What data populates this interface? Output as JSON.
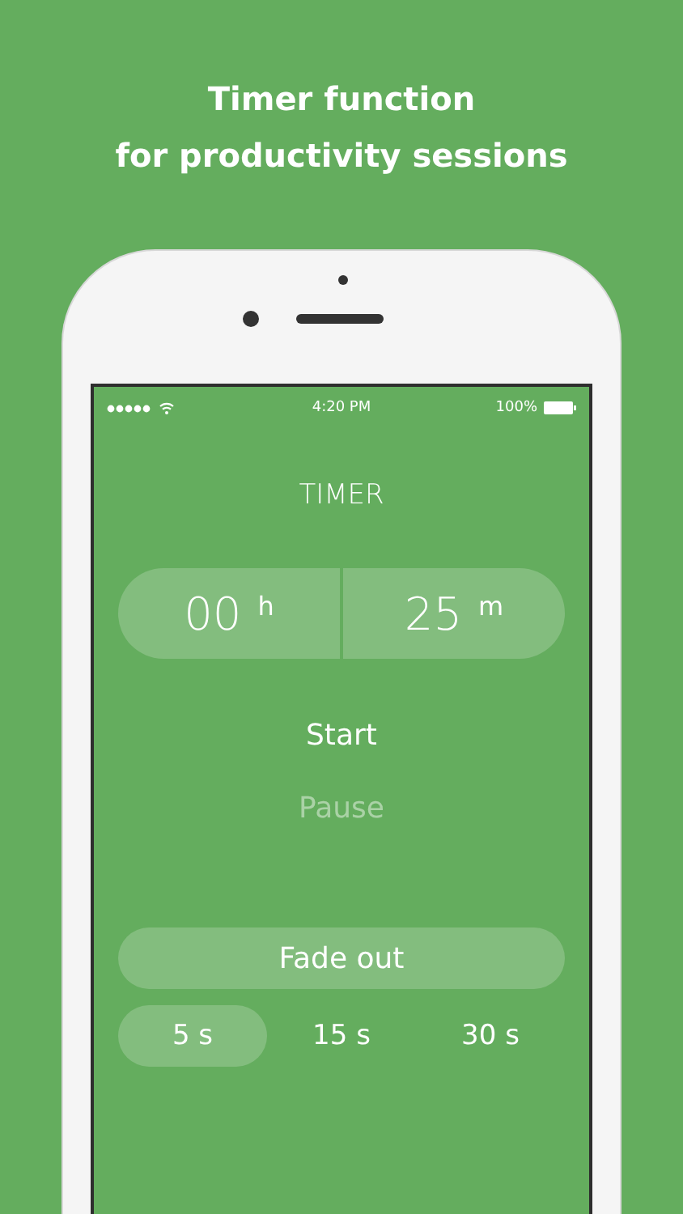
{
  "headline": {
    "lines": [
      "Timer function",
      "for productivity sessions"
    ]
  },
  "status_bar": {
    "time": "4:20 PM",
    "battery": "100%"
  },
  "title": "TIMER",
  "duration": [
    {
      "value": "00",
      "unit": "h"
    },
    {
      "value": "25",
      "unit": "m"
    }
  ],
  "actions": [
    {
      "label": "Start",
      "disabled": false
    },
    {
      "label": "Pause",
      "disabled": true
    }
  ],
  "fade_out": {
    "label": "Fade out"
  },
  "fade_options": [
    {
      "label": "5 s",
      "selected": true
    },
    {
      "label": "15 s",
      "selected": false
    },
    {
      "label": "30 s",
      "selected": false
    }
  ]
}
